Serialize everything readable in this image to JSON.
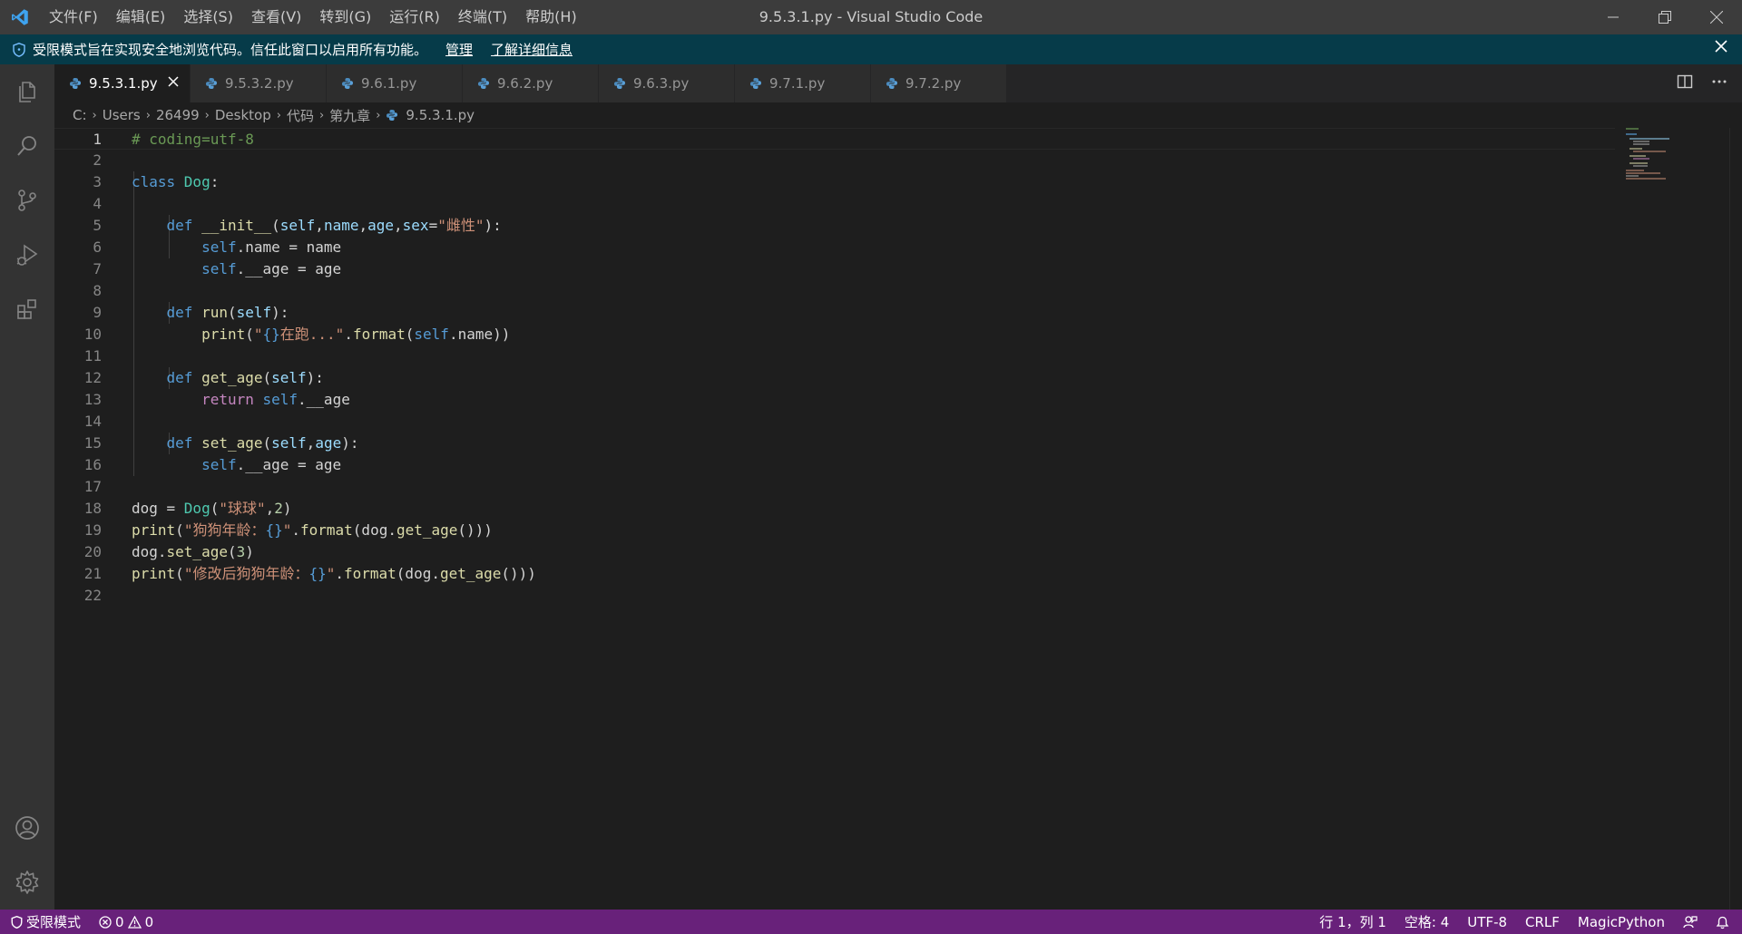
{
  "window": {
    "title": "9.5.3.1.py - Visual Studio Code",
    "menu": [
      "文件(F)",
      "编辑(E)",
      "选择(S)",
      "查看(V)",
      "转到(G)",
      "运行(R)",
      "终端(T)",
      "帮助(H)"
    ]
  },
  "banner": {
    "message": "受限模式旨在实现安全地浏览代码。信任此窗口以启用所有功能。",
    "manage_link": "管理",
    "learn_more_link": "了解详细信息"
  },
  "tabs": [
    {
      "label": "9.5.3.1.py",
      "active": true
    },
    {
      "label": "9.5.3.2.py",
      "active": false
    },
    {
      "label": "9.6.1.py",
      "active": false
    },
    {
      "label": "9.6.2.py",
      "active": false
    },
    {
      "label": "9.6.3.py",
      "active": false
    },
    {
      "label": "9.7.1.py",
      "active": false
    },
    {
      "label": "9.7.2.py",
      "active": false
    }
  ],
  "breadcrumb": [
    "C:",
    "Users",
    "26499",
    "Desktop",
    "代码",
    "第九章",
    "9.5.3.1.py"
  ],
  "editor": {
    "current_line": 1,
    "lines": [
      {
        "n": "1",
        "tokens": [
          {
            "t": "# coding=utf-8",
            "c": "com"
          }
        ]
      },
      {
        "n": "2",
        "tokens": []
      },
      {
        "n": "3",
        "tokens": [
          {
            "t": "class ",
            "c": "kw"
          },
          {
            "t": "Dog",
            "c": "cls"
          },
          {
            "t": ":",
            "c": ""
          }
        ]
      },
      {
        "n": "4",
        "tokens": []
      },
      {
        "n": "5",
        "tokens": [
          {
            "t": "    ",
            "c": ""
          },
          {
            "t": "def ",
            "c": "kw"
          },
          {
            "t": "__init__",
            "c": "fn"
          },
          {
            "t": "(",
            "c": ""
          },
          {
            "t": "self",
            "c": "var"
          },
          {
            "t": ",",
            "c": ""
          },
          {
            "t": "name",
            "c": "var"
          },
          {
            "t": ",",
            "c": ""
          },
          {
            "t": "age",
            "c": "var"
          },
          {
            "t": ",",
            "c": ""
          },
          {
            "t": "sex",
            "c": "var"
          },
          {
            "t": "=",
            "c": ""
          },
          {
            "t": "\"雌性\"",
            "c": "str"
          },
          {
            "t": "):",
            "c": ""
          }
        ]
      },
      {
        "n": "6",
        "tokens": [
          {
            "t": "        ",
            "c": ""
          },
          {
            "t": "self",
            "c": "self"
          },
          {
            "t": ".name = name",
            "c": ""
          }
        ]
      },
      {
        "n": "7",
        "tokens": [
          {
            "t": "        ",
            "c": ""
          },
          {
            "t": "self",
            "c": "self"
          },
          {
            "t": ".__age = age",
            "c": ""
          }
        ]
      },
      {
        "n": "8",
        "tokens": []
      },
      {
        "n": "9",
        "tokens": [
          {
            "t": "    ",
            "c": ""
          },
          {
            "t": "def ",
            "c": "kw"
          },
          {
            "t": "run",
            "c": "fn"
          },
          {
            "t": "(",
            "c": ""
          },
          {
            "t": "self",
            "c": "var"
          },
          {
            "t": "):",
            "c": ""
          }
        ]
      },
      {
        "n": "10",
        "tokens": [
          {
            "t": "        ",
            "c": ""
          },
          {
            "t": "print",
            "c": "fn"
          },
          {
            "t": "(",
            "c": ""
          },
          {
            "t": "\"",
            "c": "str"
          },
          {
            "t": "{}",
            "c": "fmt"
          },
          {
            "t": "在跑...\"",
            "c": "str"
          },
          {
            "t": ".",
            "c": ""
          },
          {
            "t": "format",
            "c": "fn"
          },
          {
            "t": "(",
            "c": ""
          },
          {
            "t": "self",
            "c": "self"
          },
          {
            "t": ".name))",
            "c": ""
          }
        ]
      },
      {
        "n": "11",
        "tokens": []
      },
      {
        "n": "12",
        "tokens": [
          {
            "t": "    ",
            "c": ""
          },
          {
            "t": "def ",
            "c": "kw"
          },
          {
            "t": "get_age",
            "c": "fn"
          },
          {
            "t": "(",
            "c": ""
          },
          {
            "t": "self",
            "c": "var"
          },
          {
            "t": "):",
            "c": ""
          }
        ]
      },
      {
        "n": "13",
        "tokens": [
          {
            "t": "        ",
            "c": ""
          },
          {
            "t": "return ",
            "c": "ctl"
          },
          {
            "t": "self",
            "c": "self"
          },
          {
            "t": ".__age",
            "c": ""
          }
        ]
      },
      {
        "n": "14",
        "tokens": []
      },
      {
        "n": "15",
        "tokens": [
          {
            "t": "    ",
            "c": ""
          },
          {
            "t": "def ",
            "c": "kw"
          },
          {
            "t": "set_age",
            "c": "fn"
          },
          {
            "t": "(",
            "c": ""
          },
          {
            "t": "self",
            "c": "var"
          },
          {
            "t": ",",
            "c": ""
          },
          {
            "t": "age",
            "c": "var"
          },
          {
            "t": "):",
            "c": ""
          }
        ]
      },
      {
        "n": "16",
        "tokens": [
          {
            "t": "        ",
            "c": ""
          },
          {
            "t": "self",
            "c": "self"
          },
          {
            "t": ".__age = age",
            "c": ""
          }
        ]
      },
      {
        "n": "17",
        "tokens": []
      },
      {
        "n": "18",
        "tokens": [
          {
            "t": "dog = ",
            "c": ""
          },
          {
            "t": "Dog",
            "c": "cls"
          },
          {
            "t": "(",
            "c": ""
          },
          {
            "t": "\"球球\"",
            "c": "str"
          },
          {
            "t": ",",
            "c": ""
          },
          {
            "t": "2",
            "c": "num"
          },
          {
            "t": ")",
            "c": ""
          }
        ]
      },
      {
        "n": "19",
        "tokens": [
          {
            "t": "print",
            "c": "fn"
          },
          {
            "t": "(",
            "c": ""
          },
          {
            "t": "\"狗狗年龄：",
            "c": "str"
          },
          {
            "t": "{}",
            "c": "fmt"
          },
          {
            "t": "\"",
            "c": "str"
          },
          {
            "t": ".",
            "c": ""
          },
          {
            "t": "format",
            "c": "fn"
          },
          {
            "t": "(dog.",
            "c": ""
          },
          {
            "t": "get_age",
            "c": "fn"
          },
          {
            "t": "()))",
            "c": ""
          }
        ]
      },
      {
        "n": "20",
        "tokens": [
          {
            "t": "dog.",
            "c": ""
          },
          {
            "t": "set_age",
            "c": "fn"
          },
          {
            "t": "(",
            "c": ""
          },
          {
            "t": "3",
            "c": "num"
          },
          {
            "t": ")",
            "c": ""
          }
        ]
      },
      {
        "n": "21",
        "tokens": [
          {
            "t": "print",
            "c": "fn"
          },
          {
            "t": "(",
            "c": ""
          },
          {
            "t": "\"修改后狗狗年龄：",
            "c": "str"
          },
          {
            "t": "{}",
            "c": "fmt"
          },
          {
            "t": "\"",
            "c": "str"
          },
          {
            "t": ".",
            "c": ""
          },
          {
            "t": "format",
            "c": "fn"
          },
          {
            "t": "(dog.",
            "c": ""
          },
          {
            "t": "get_age",
            "c": "fn"
          },
          {
            "t": "()))",
            "c": ""
          }
        ]
      },
      {
        "n": "22",
        "tokens": []
      }
    ]
  },
  "statusbar": {
    "restricted": "受限模式",
    "errors": "0",
    "warnings": "0",
    "position": "行 1，列 1",
    "spaces": "空格: 4",
    "encoding": "UTF-8",
    "eol": "CRLF",
    "language": "MagicPython"
  },
  "icons": {
    "activity": [
      "explorer-icon",
      "search-icon",
      "source-control-icon",
      "run-debug-icon",
      "extensions-icon"
    ],
    "activity_bottom": [
      "account-icon",
      "settings-gear-icon"
    ]
  },
  "colors": {
    "statusbar": "#68217a",
    "banner": "#063b49",
    "accent": "#007acc"
  }
}
